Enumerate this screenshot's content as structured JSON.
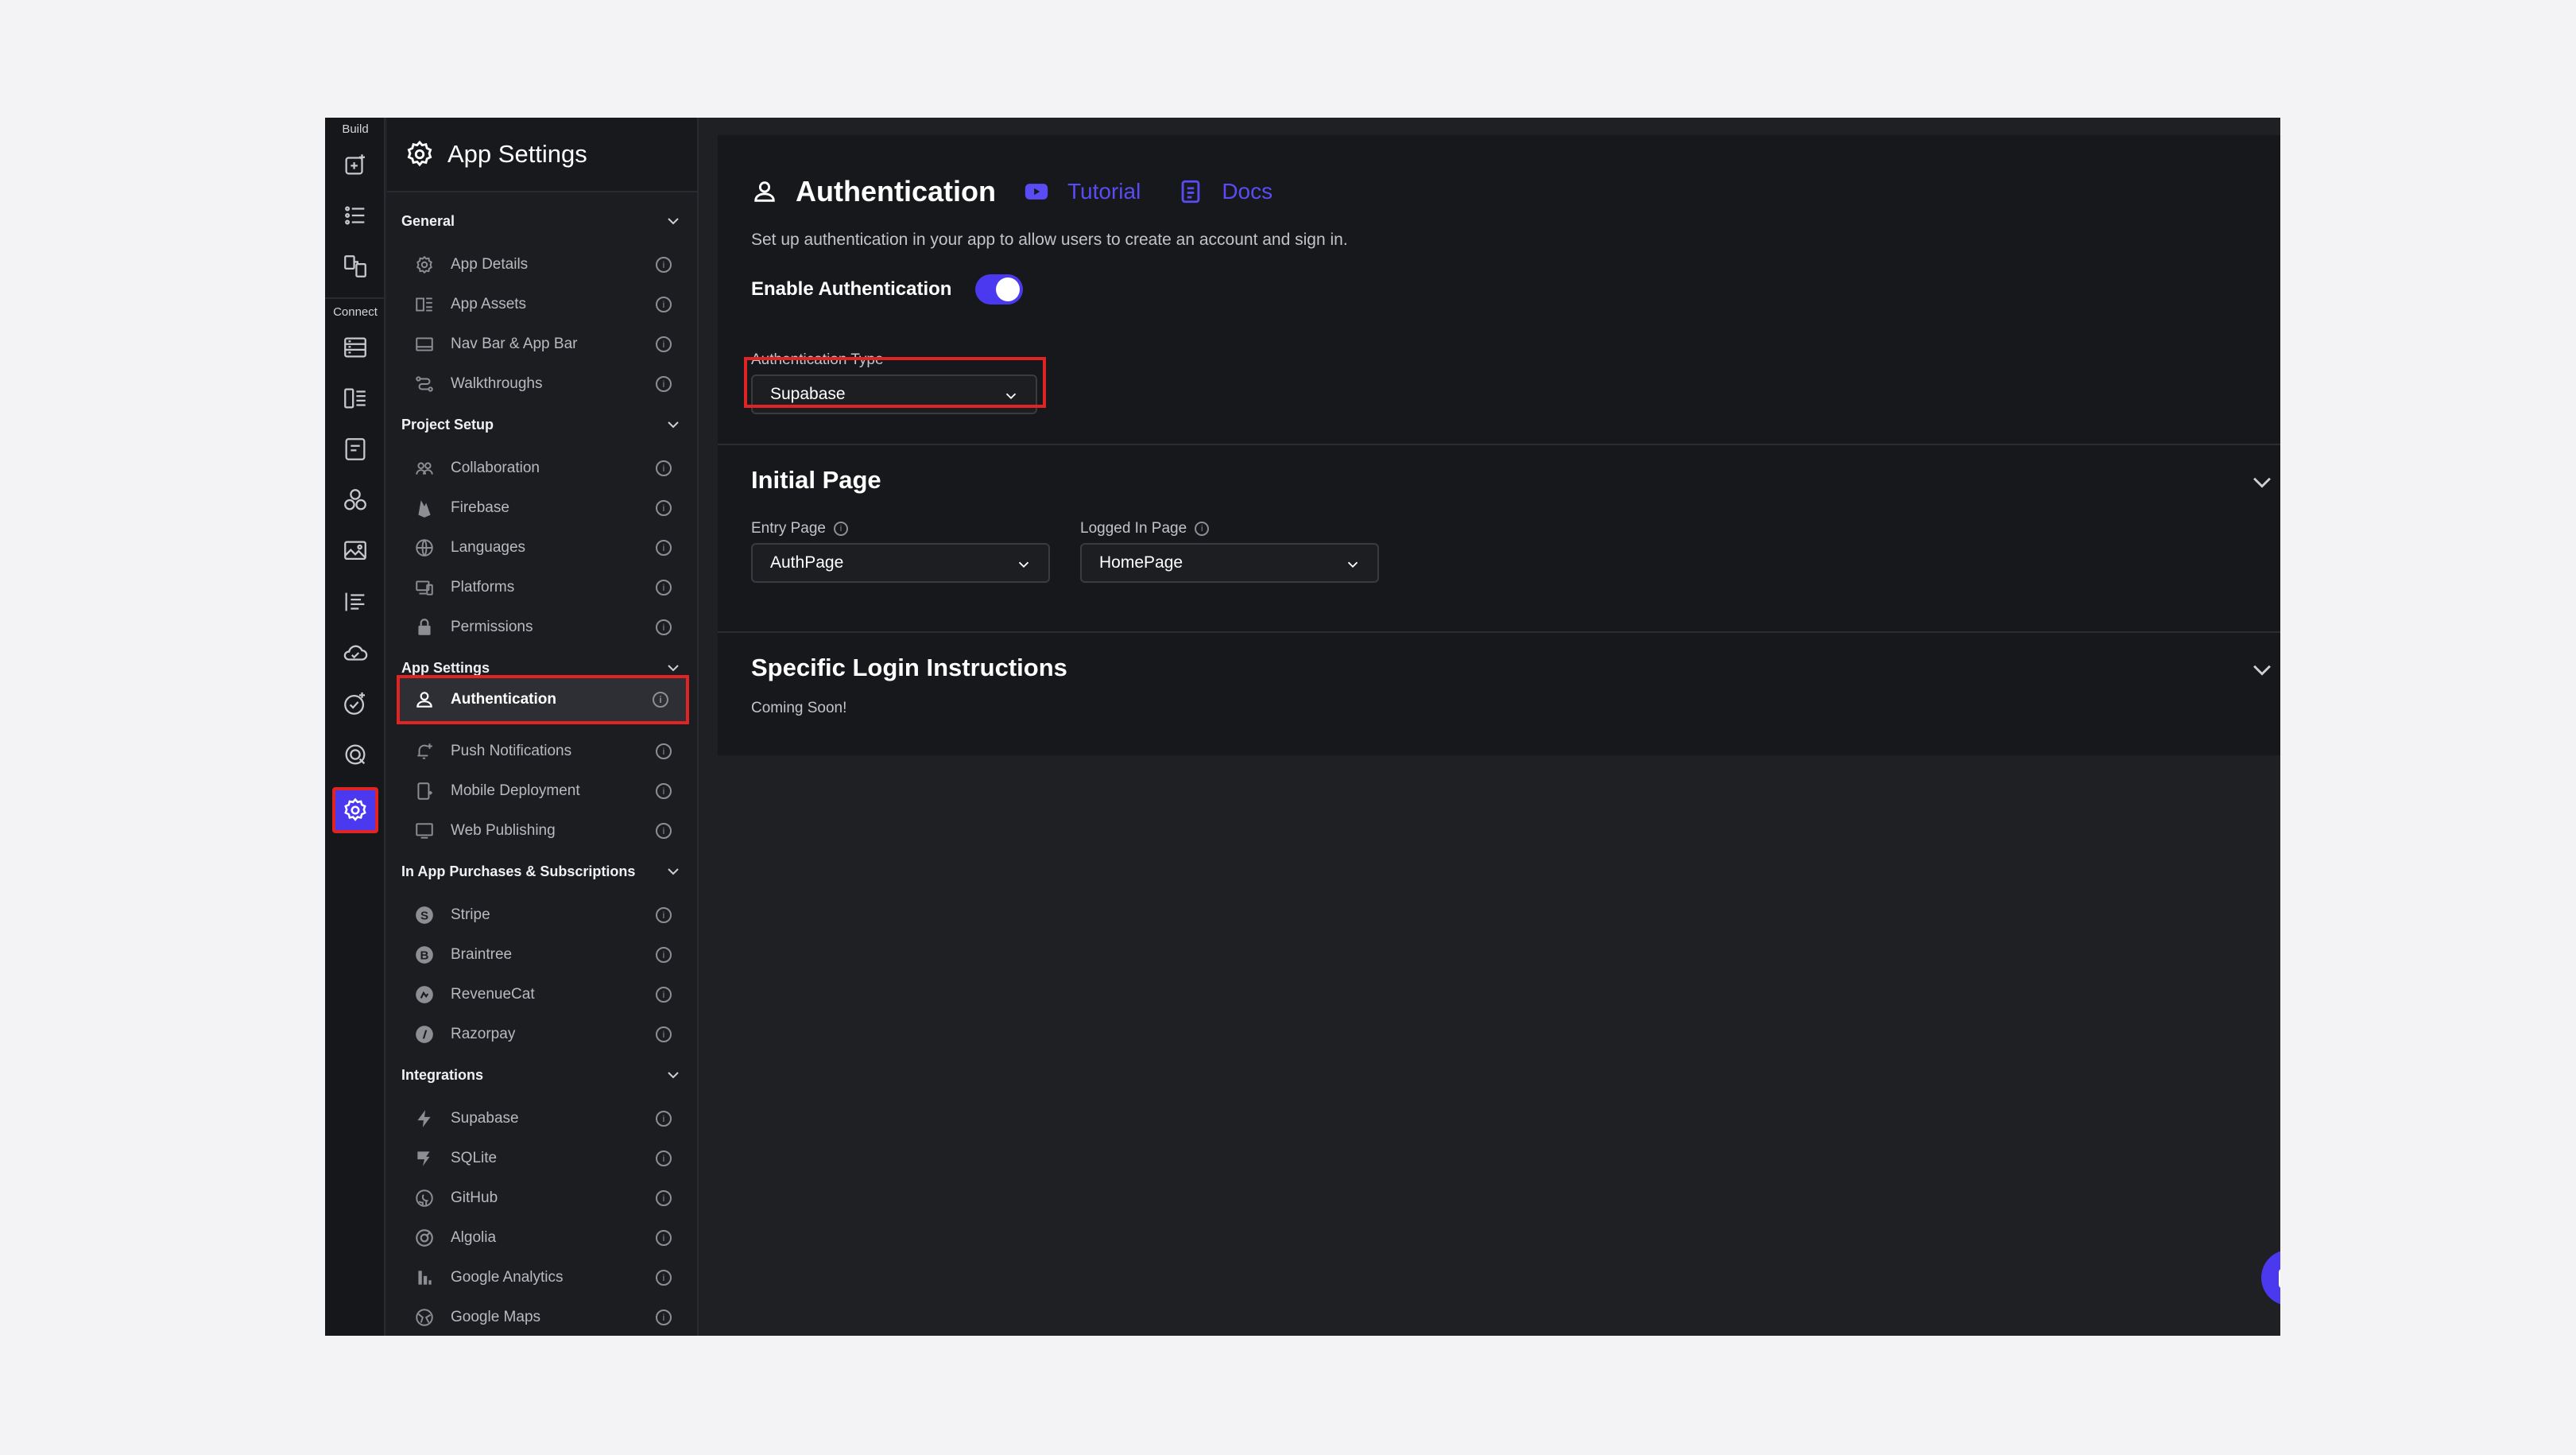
{
  "rail": {
    "build_label": "Build",
    "connect_label": "Connect",
    "icons": [
      "add-widget-icon",
      "list-icon",
      "page-flow-icon",
      "database-icon",
      "collection-icon",
      "api-icon",
      "integrations-icon",
      "media-icon",
      "text-style-icon",
      "cloud-icon",
      "test-icon",
      "theme-icon",
      "gear-icon"
    ]
  },
  "sidebar": {
    "title": "App Settings",
    "sections": [
      {
        "label": "General",
        "items": [
          {
            "label": "App Details",
            "icon": "gear-cog-icon"
          },
          {
            "label": "App Assets",
            "icon": "assets-icon"
          },
          {
            "label": "Nav Bar & App Bar",
            "icon": "navbar-icon"
          },
          {
            "label": "Walkthroughs",
            "icon": "walkthrough-icon"
          }
        ]
      },
      {
        "label": "Project Setup",
        "items": [
          {
            "label": "Collaboration",
            "icon": "collaboration-icon"
          },
          {
            "label": "Firebase",
            "icon": "firebase-icon"
          },
          {
            "label": "Languages",
            "icon": "globe-icon"
          },
          {
            "label": "Platforms",
            "icon": "devices-icon"
          },
          {
            "label": "Permissions",
            "icon": "lock-icon"
          }
        ]
      },
      {
        "label": "App Settings",
        "items": [
          {
            "label": "Authentication",
            "icon": "person-icon"
          },
          {
            "label": "Push Notifications",
            "icon": "notification-icon"
          },
          {
            "label": "Mobile Deployment",
            "icon": "mobile-icon"
          },
          {
            "label": "Web Publishing",
            "icon": "monitor-icon"
          }
        ]
      },
      {
        "label": "In App Purchases & Subscriptions",
        "items": [
          {
            "label": "Stripe",
            "icon": "stripe-icon"
          },
          {
            "label": "Braintree",
            "icon": "braintree-icon"
          },
          {
            "label": "RevenueCat",
            "icon": "revenuecat-icon"
          },
          {
            "label": "Razorpay",
            "icon": "razorpay-icon"
          }
        ]
      },
      {
        "label": "Integrations",
        "items": [
          {
            "label": "Supabase",
            "icon": "bolt-icon"
          },
          {
            "label": "SQLite",
            "icon": "sqlite-icon"
          },
          {
            "label": "GitHub",
            "icon": "github-icon"
          },
          {
            "label": "Algolia",
            "icon": "algolia-icon"
          },
          {
            "label": "Google Analytics",
            "icon": "bar-chart-icon"
          },
          {
            "label": "Google Maps",
            "icon": "maps-icon"
          }
        ]
      }
    ]
  },
  "main": {
    "title": "Authentication",
    "tutorial_label": "Tutorial",
    "docs_label": "Docs",
    "description": "Set up authentication in your app to allow users to create an account and sign in.",
    "enable_label": "Enable Authentication",
    "enable_on": true,
    "auth_type_label": "Authentication Type",
    "auth_type_value": "Supabase",
    "initial_page": {
      "title": "Initial Page",
      "entry_label": "Entry Page",
      "entry_value": "AuthPage",
      "logged_in_label": "Logged In Page",
      "logged_in_value": "HomePage"
    },
    "login_instructions": {
      "title": "Specific Login Instructions",
      "text": "Coming Soon!"
    }
  },
  "colors": {
    "accent": "#4b39ef",
    "highlight": "#e02424",
    "background": "#17181b"
  }
}
